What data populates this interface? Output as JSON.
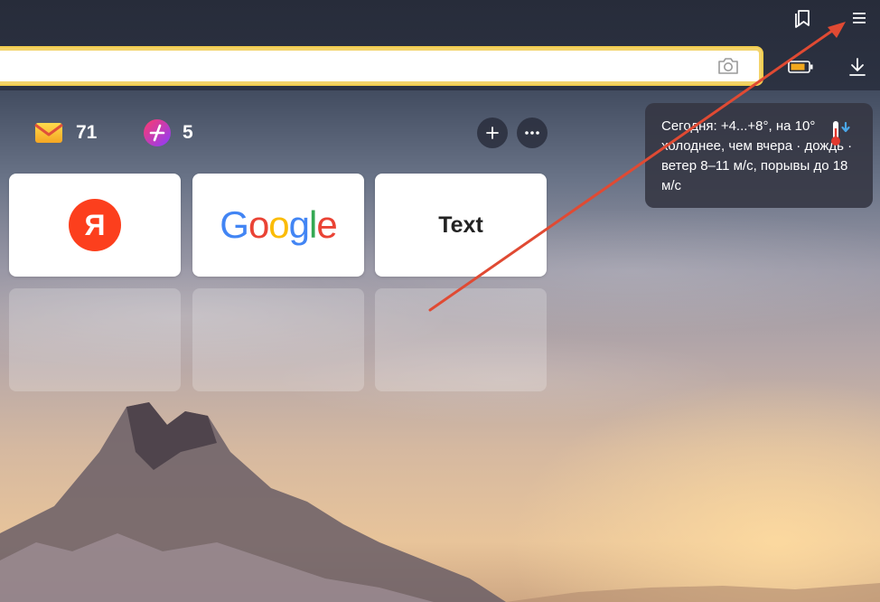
{
  "counters": {
    "mail": {
      "icon": "mail-icon",
      "count": "71"
    },
    "zen": {
      "icon": "plus-circle-icon",
      "count": "5"
    }
  },
  "address_bar": {
    "value": "",
    "placeholder": ""
  },
  "weather": {
    "text": "Сегодня: +4...+8°, на 10° холоднее, чем вчера · дождь · ветер 8–11 м/с, порывы до 18 м/с",
    "icon": "thermometer-down-icon"
  },
  "tiles": [
    {
      "type": "logo",
      "label": "Я",
      "icon": "yandex-logo"
    },
    {
      "type": "logo",
      "label": "Google",
      "icon": "google-logo"
    },
    {
      "type": "text",
      "label": "Text"
    }
  ],
  "colors": {
    "accent_yellow": "#f2cd4f",
    "yandex_red": "#fc3f1d",
    "arrow_red": "#e04a33"
  }
}
